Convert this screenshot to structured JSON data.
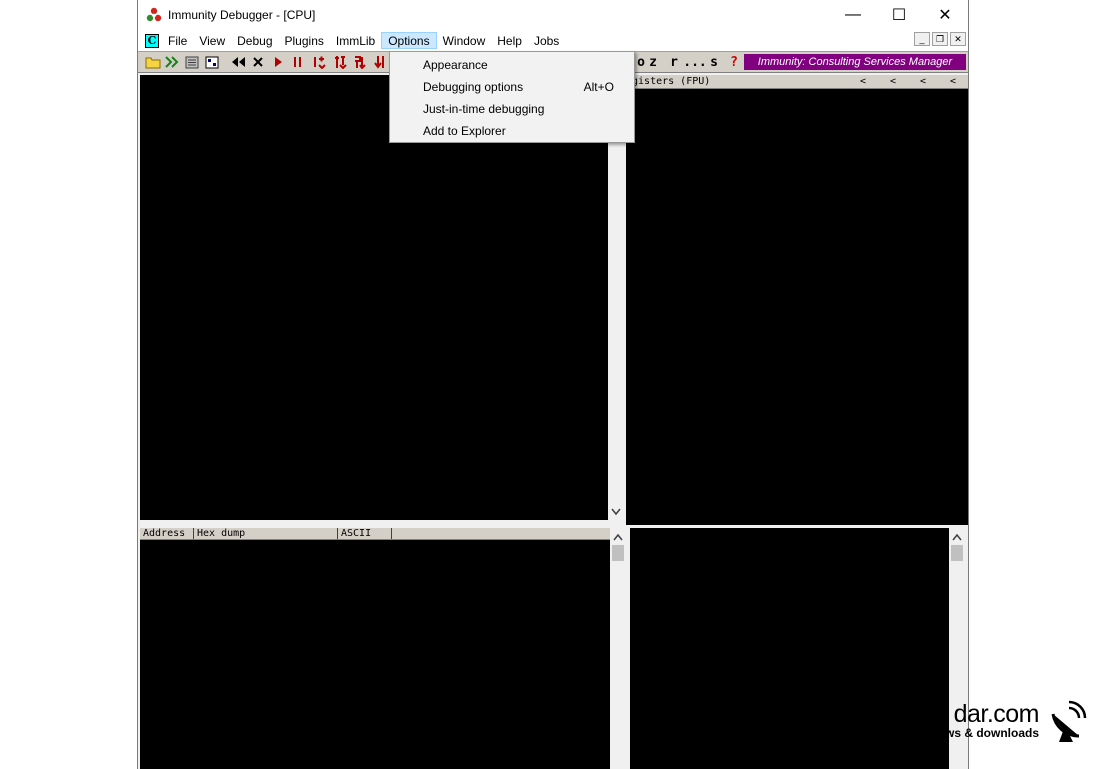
{
  "window": {
    "title": "Immunity Debugger - [CPU]"
  },
  "titlebar_buttons": {
    "minimize": "—",
    "maximize": "☐",
    "close": "✕"
  },
  "menubar": {
    "items": [
      "File",
      "View",
      "Debug",
      "Plugins",
      "ImmLib",
      "Options",
      "Window",
      "Help",
      "Jobs"
    ],
    "active": "Options"
  },
  "toolbar": {
    "letter_buttons": [
      "o",
      "z",
      "r",
      "...",
      "s",
      "?"
    ],
    "banner": "Immunity: Consulting Services Manager"
  },
  "options_menu": {
    "items": [
      {
        "label": "Appearance",
        "shortcut": ""
      },
      {
        "label": "Debugging options",
        "shortcut": "Alt+O"
      },
      {
        "label": "Just-in-time debugging",
        "shortcut": ""
      },
      {
        "label": "Add to Explorer",
        "shortcut": ""
      }
    ]
  },
  "registers_pane": {
    "header": "egisters (FPU)",
    "arrows": [
      "<",
      "<",
      "<",
      "<"
    ]
  },
  "dump_pane": {
    "columns": [
      "Address",
      "Hex dump",
      "ASCII"
    ]
  },
  "watermark": {
    "text_large": "dar.com",
    "text_small": "ws & downloads"
  },
  "colors": {
    "banner_bg": "#800080",
    "pane_bg": "#000000",
    "menu_highlight": "#cce8ff"
  }
}
